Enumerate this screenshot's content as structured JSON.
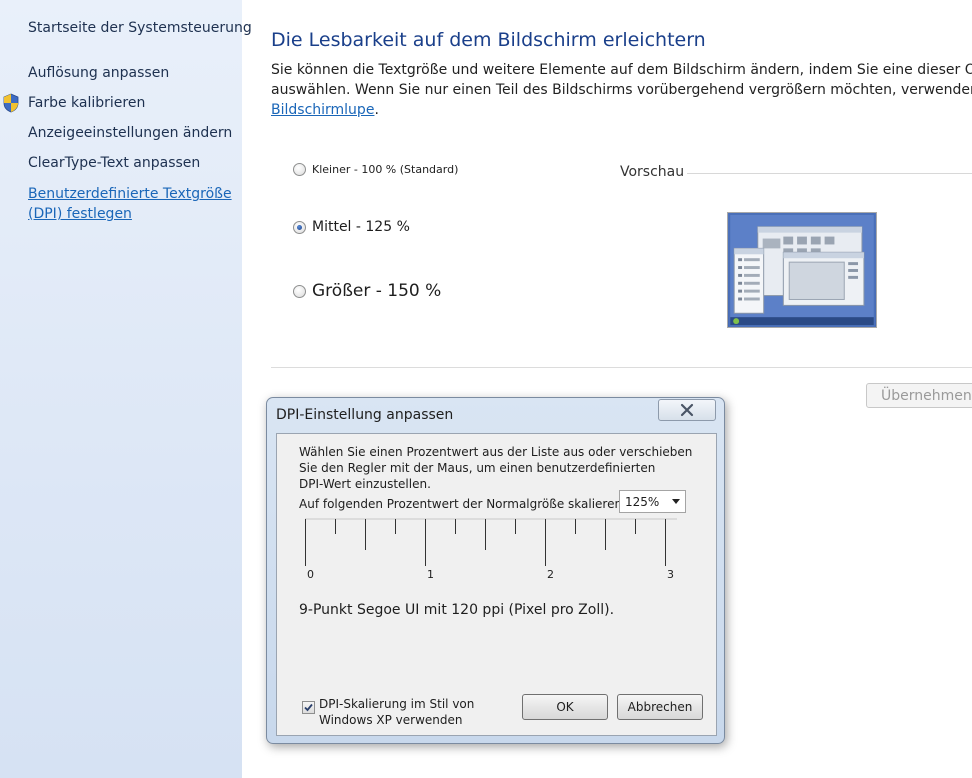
{
  "sidebar": {
    "items": [
      {
        "label": "Startseite der Systemsteuerung"
      },
      {
        "label": "Auflösung anpassen"
      },
      {
        "label": "Farbe kalibrieren"
      },
      {
        "label": "Anzeigeeinstellungen ändern"
      },
      {
        "label": "ClearType-Text anpassen"
      },
      {
        "label_line1": "Benutzerdefinierte Textgröße ",
        "label_line2": "(DPI) festlegen"
      }
    ]
  },
  "main": {
    "title": "Die Lesbarkeit auf dem Bildschirm erleichtern",
    "desc_line1": "Sie können die Textgröße und weitere Elemente auf dem Bildschirm ändern, indem Sie eine dieser Optione",
    "desc_line2": "auswählen. Wenn Sie nur einen Teil des Bildschirms vorübergehend vergrößern möchten, verwenden Sie di",
    "desc_link": "Bildschirmlupe",
    "desc_link_suffix": ".",
    "options": [
      {
        "label": "Kleiner - 100 % (Standard)",
        "checked": false
      },
      {
        "label": "Mittel - 125 %",
        "checked": true
      },
      {
        "label": "Größer - 150 %",
        "checked": false
      }
    ],
    "preview_label": "Vorschau",
    "apply_label": "Übernehmen"
  },
  "dialog": {
    "title": "DPI-Einstellung anpassen",
    "text_line1": "Wählen Sie einen Prozentwert aus der Liste aus oder verschieben",
    "text_line2": "Sie den Regler mit der Maus, um einen benutzerdefinierten",
    "text_line3": "DPI-Wert einzustellen.",
    "scale_label": "Auf folgenden Prozentwert der Normalgröße skalieren:",
    "scale_value": "125%",
    "ruler_labels": [
      "0",
      "1",
      "2",
      "3"
    ],
    "dpi_info": "9-Punkt Segoe UI mit 120 ppi (Pixel pro Zoll).",
    "checkbox_line1": "DPI-Skalierung im Stil von",
    "checkbox_line2": "Windows XP verwenden",
    "checkbox_checked": true,
    "ok_label": "OK",
    "cancel_label": "Abbrechen"
  },
  "colors": {
    "link": "#1a66b8",
    "title": "#1a3f8a",
    "sidebar_bg": "#dde7f6"
  }
}
